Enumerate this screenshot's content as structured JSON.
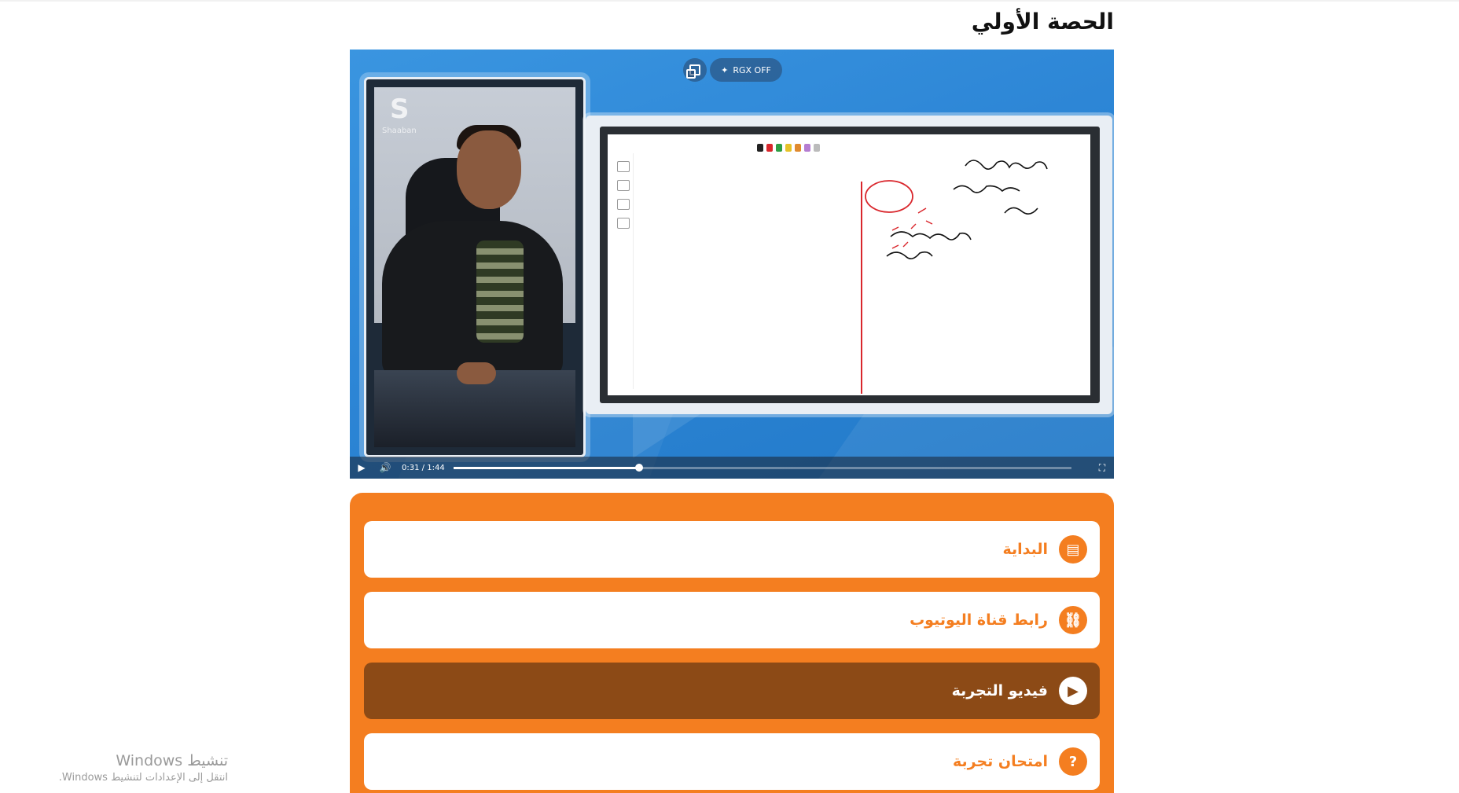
{
  "page": {
    "title": "الحصة الأولي"
  },
  "player": {
    "rgx_label": "RGX OFF",
    "current_time": "0:31",
    "separator": "/",
    "duration": "1:44",
    "progress_fraction": 0.3,
    "teacher_logo": "Shaaban"
  },
  "menu": {
    "items": [
      {
        "label": "البداية",
        "icon": "document-icon",
        "active": false
      },
      {
        "label": "رابط قناة اليوتيوب",
        "icon": "link-icon",
        "active": false
      },
      {
        "label": "فيديو التجربة",
        "icon": "play-icon",
        "active": true
      },
      {
        "label": "امتحان تجربة",
        "icon": "question-icon",
        "active": false
      }
    ]
  },
  "colors": {
    "accent": "#f47e20",
    "active_item": "#8c4a16",
    "player_bg": "#2d86d6"
  },
  "watermark": {
    "line1": "تنشيط Windows",
    "line2": "انتقل إلى الإعدادات لتنشيط Windows."
  }
}
